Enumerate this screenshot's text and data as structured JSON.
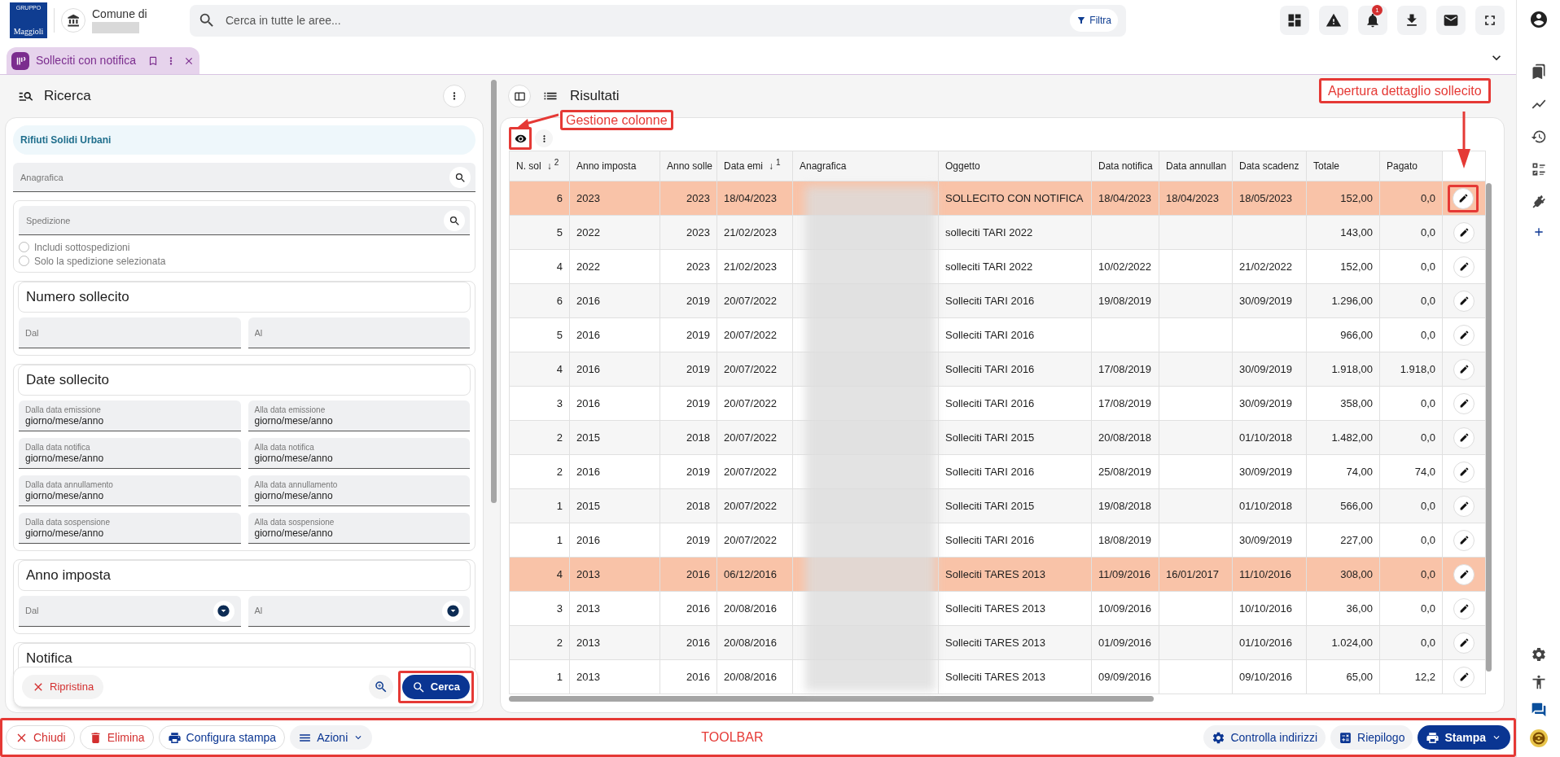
{
  "top_bar": {
    "logo": {
      "group": "GRUPPO",
      "name": "Maggioli"
    },
    "org_label": "Comune di",
    "search": {
      "placeholder": "Cerca in tutte le aree..."
    },
    "filter_button": "Filtra",
    "notifications_badge": "1"
  },
  "tabs": [
    {
      "label": "Solleciti con notifica",
      "selected": true
    }
  ],
  "search_panel": {
    "title": "Ricerca",
    "category": "Rifiuti Solidi Urbani",
    "anagrafica": {
      "placeholder": "Anagrafica"
    },
    "spedizione": {
      "placeholder": "Spedizione",
      "options": [
        {
          "label": "Includi sottospedizioni",
          "selected": false
        },
        {
          "label": "Solo la spedizione selezionata",
          "selected": false
        }
      ]
    },
    "sections": [
      {
        "title": "Numero sollecito",
        "fields": [
          {
            "kind": "text",
            "placeholder": "Dal"
          },
          {
            "kind": "text",
            "placeholder": "Al"
          }
        ]
      },
      {
        "title": "Date sollecito",
        "fields": [
          {
            "kind": "date",
            "label": "Dalla data emissione",
            "value": "giorno/mese/anno"
          },
          {
            "kind": "date",
            "label": "Alla data emissione",
            "value": "giorno/mese/anno"
          },
          {
            "kind": "date",
            "label": "Dalla data notifica",
            "value": "giorno/mese/anno"
          },
          {
            "kind": "date",
            "label": "Alla data notifica",
            "value": "giorno/mese/anno"
          },
          {
            "kind": "date",
            "label": "Dalla data annullamento",
            "value": "giorno/mese/anno"
          },
          {
            "kind": "date",
            "label": "Alla data annullamento",
            "value": "giorno/mese/anno"
          },
          {
            "kind": "date",
            "label": "Dalla data sospensione",
            "value": "giorno/mese/anno"
          },
          {
            "kind": "date",
            "label": "Alla data sospensione",
            "value": "giorno/mese/anno"
          }
        ]
      },
      {
        "title": "Anno imposta",
        "fields": [
          {
            "kind": "select",
            "label": "Dal"
          },
          {
            "kind": "select",
            "label": "Al"
          }
        ]
      },
      {
        "title": "Notifica"
      }
    ],
    "actions": {
      "reset": "Ripristina",
      "search": "Cerca",
      "search_framed": true
    }
  },
  "results": {
    "title": "Risultati",
    "columns_button_framed": true,
    "columns": [
      {
        "label": "N. sol",
        "kind": "number",
        "sort": "↓",
        "sort_rank": "2"
      },
      {
        "label": "Anno imposta",
        "kind": "text"
      },
      {
        "label": "Anno solle",
        "kind": "number"
      },
      {
        "label": "Data emi",
        "kind": "text",
        "sort": "↓",
        "sort_rank": "1"
      },
      {
        "label": "Anagrafica",
        "kind": "text"
      },
      {
        "label": "Oggetto",
        "kind": "text"
      },
      {
        "label": "Data notifica",
        "kind": "text"
      },
      {
        "label": "Data annullan",
        "kind": "text"
      },
      {
        "label": "Data scadenz",
        "kind": "text"
      },
      {
        "label": "Totale",
        "kind": "number"
      },
      {
        "label": "Pagato",
        "kind": "number"
      }
    ],
    "rows": [
      {
        "highlighted": true,
        "framed": true,
        "cells": [
          "6",
          "2023",
          "2023",
          "18/04/2023",
          null,
          "SOLLECITO CON NOTIFICA",
          "18/04/2023",
          "18/04/2023",
          "18/05/2023",
          "152,00",
          "0,0"
        ]
      },
      {
        "highlighted": false,
        "framed": false,
        "cells": [
          "5",
          "2022",
          "2023",
          "21/02/2023",
          null,
          "solleciti TARI 2022",
          null,
          null,
          null,
          "143,00",
          "0,0"
        ]
      },
      {
        "highlighted": false,
        "framed": false,
        "cells": [
          "4",
          "2022",
          "2023",
          "21/02/2023",
          null,
          "solleciti TARI 2022",
          "10/02/2022",
          null,
          "21/02/2022",
          "152,00",
          "0,0"
        ]
      },
      {
        "highlighted": false,
        "framed": false,
        "cells": [
          "6",
          "2016",
          "2019",
          "20/07/2022",
          null,
          "Solleciti TARI 2016",
          "19/08/2019",
          null,
          "30/09/2019",
          "1.296,00",
          "0,0"
        ]
      },
      {
        "highlighted": false,
        "framed": false,
        "cells": [
          "5",
          "2016",
          "2019",
          "20/07/2022",
          null,
          "Solleciti TARI 2016",
          null,
          null,
          null,
          "966,00",
          "0,0"
        ]
      },
      {
        "highlighted": false,
        "framed": false,
        "cells": [
          "4",
          "2016",
          "2019",
          "20/07/2022",
          null,
          "Solleciti TARI 2016",
          "17/08/2019",
          null,
          "30/09/2019",
          "1.918,00",
          "1.918,0"
        ]
      },
      {
        "highlighted": false,
        "framed": false,
        "cells": [
          "3",
          "2016",
          "2019",
          "20/07/2022",
          null,
          "Solleciti TARI 2016",
          "17/08/2019",
          null,
          "30/09/2019",
          "358,00",
          "0,0"
        ]
      },
      {
        "highlighted": false,
        "framed": false,
        "cells": [
          "2",
          "2015",
          "2018",
          "20/07/2022",
          null,
          "Solleciti TARI 2015",
          "20/08/2018",
          null,
          "01/10/2018",
          "1.482,00",
          "0,0"
        ]
      },
      {
        "highlighted": false,
        "framed": false,
        "cells": [
          "2",
          "2016",
          "2019",
          "20/07/2022",
          null,
          "Solleciti TARI 2016",
          "25/08/2019",
          null,
          "30/09/2019",
          "74,00",
          "74,0"
        ]
      },
      {
        "highlighted": false,
        "framed": false,
        "cells": [
          "1",
          "2015",
          "2018",
          "20/07/2022",
          null,
          "Solleciti TARI 2015",
          "19/08/2018",
          null,
          "01/10/2018",
          "566,00",
          "0,0"
        ]
      },
      {
        "highlighted": false,
        "framed": false,
        "cells": [
          "1",
          "2016",
          "2019",
          "20/07/2022",
          null,
          "Solleciti TARI 2016",
          "18/08/2019",
          null,
          "30/09/2019",
          "227,00",
          "0,0"
        ]
      },
      {
        "highlighted": true,
        "framed": false,
        "cells": [
          "4",
          "2013",
          "2016",
          "06/12/2016",
          null,
          "Solleciti TARES 2013",
          "11/09/2016",
          "16/01/2017",
          "11/10/2016",
          "308,00",
          "0,0"
        ]
      },
      {
        "highlighted": false,
        "framed": false,
        "cells": [
          "3",
          "2013",
          "2016",
          "20/08/2016",
          null,
          "Solleciti TARES 2013",
          "10/09/2016",
          null,
          "10/10/2016",
          "36,00",
          "0,0"
        ]
      },
      {
        "highlighted": false,
        "framed": false,
        "cells": [
          "2",
          "2013",
          "2016",
          "20/08/2016",
          null,
          "Solleciti TARES 2013",
          "01/09/2016",
          null,
          "01/10/2016",
          "1.024,00",
          "0,0"
        ]
      },
      {
        "highlighted": false,
        "framed": false,
        "cells": [
          "1",
          "2013",
          "2016",
          "20/08/2016",
          null,
          "Solleciti TARES 2013",
          "09/09/2016",
          null,
          "09/10/2016",
          "65,00",
          "12,2"
        ]
      }
    ]
  },
  "annotations": [
    {
      "kind": "columns-callout",
      "text": "Gestione colonne"
    },
    {
      "kind": "detail-callout",
      "text": "Apertura dettaglio sollecito"
    },
    {
      "kind": "toolbar-label",
      "text": "TOOLBAR"
    }
  ],
  "toolbar": {
    "framed": true,
    "left": [
      {
        "kind": "danger",
        "label": "Chiudi"
      },
      {
        "kind": "danger",
        "label": "Elimina"
      },
      {
        "kind": "outline",
        "label": "Configura stampa"
      },
      {
        "kind": "menu",
        "label": "Azioni"
      }
    ],
    "right": [
      {
        "kind": "tonal",
        "label": "Controlla indirizzi"
      },
      {
        "kind": "tonal",
        "label": "Riepilogo"
      },
      {
        "kind": "primary",
        "label": "Stampa"
      }
    ]
  }
}
